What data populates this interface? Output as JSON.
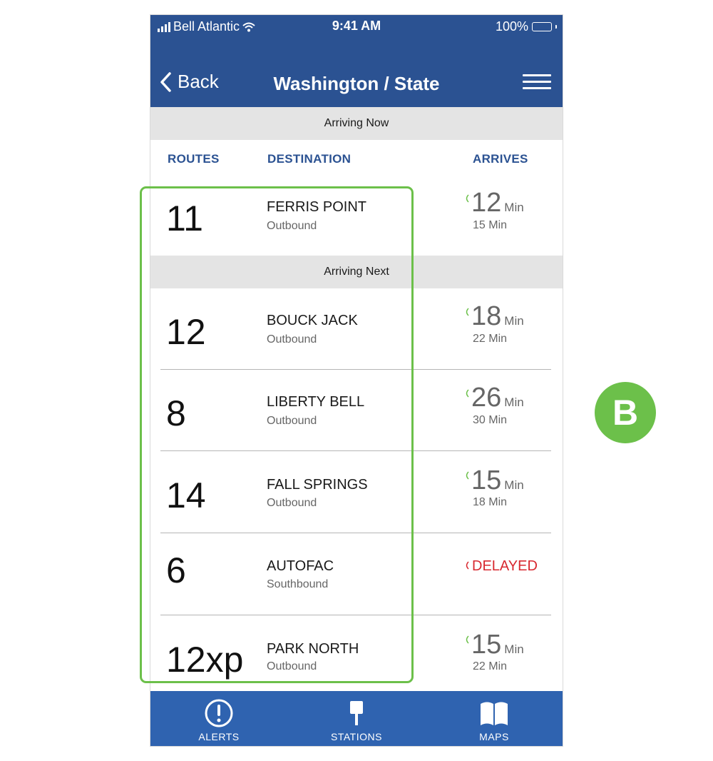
{
  "status_bar": {
    "carrier": "Bell Atlantic",
    "time": "9:41 AM",
    "battery": "100%"
  },
  "nav": {
    "back_label": "Back",
    "title": "Washington / State"
  },
  "sections": {
    "now": "Arriving Now",
    "next": "Arriving Next"
  },
  "columns": {
    "routes": "ROUTES",
    "destination": "DESTINATION",
    "arrives": "ARRIVES"
  },
  "rows": [
    {
      "route": "11",
      "destination": "FERRIS POINT",
      "direction": "Outbound",
      "arrives": "12",
      "unit": "Min",
      "next": "15 Min",
      "status": "live"
    },
    {
      "route": "12",
      "destination": "BOUCK JACK",
      "direction": "Outbound",
      "arrives": "18",
      "unit": "Min",
      "next": "22 Min",
      "status": "live"
    },
    {
      "route": "8",
      "destination": "LIBERTY BELL",
      "direction": "Outbound",
      "arrives": "26",
      "unit": "Min",
      "next": "30 Min",
      "status": "live"
    },
    {
      "route": "14",
      "destination": "FALL SPRINGS",
      "direction": "Outbound",
      "arrives": "15",
      "unit": "Min",
      "next": "18 Min",
      "status": "live"
    },
    {
      "route": "6",
      "destination": "AUTOFAC",
      "direction": "Southbound",
      "delayed": "DELAYED",
      "status": "delayed"
    },
    {
      "route": "12xp",
      "destination": "PARK NORTH",
      "direction": "Outbound",
      "arrives": "15",
      "unit": "Min",
      "next": "22 Min",
      "status": "live"
    }
  ],
  "tabs": [
    {
      "label": "ALERTS",
      "icon": "alert-icon"
    },
    {
      "label": "STATIONS",
      "icon": "station-icon"
    },
    {
      "label": "MAPS",
      "icon": "map-icon"
    }
  ],
  "callout": {
    "letter": "B"
  },
  "colors": {
    "primary": "#2b5292",
    "tabbar": "#2f63b0",
    "live": "#6cc04a",
    "delayed": "#d8282f",
    "highlight": "#6cc04a"
  }
}
